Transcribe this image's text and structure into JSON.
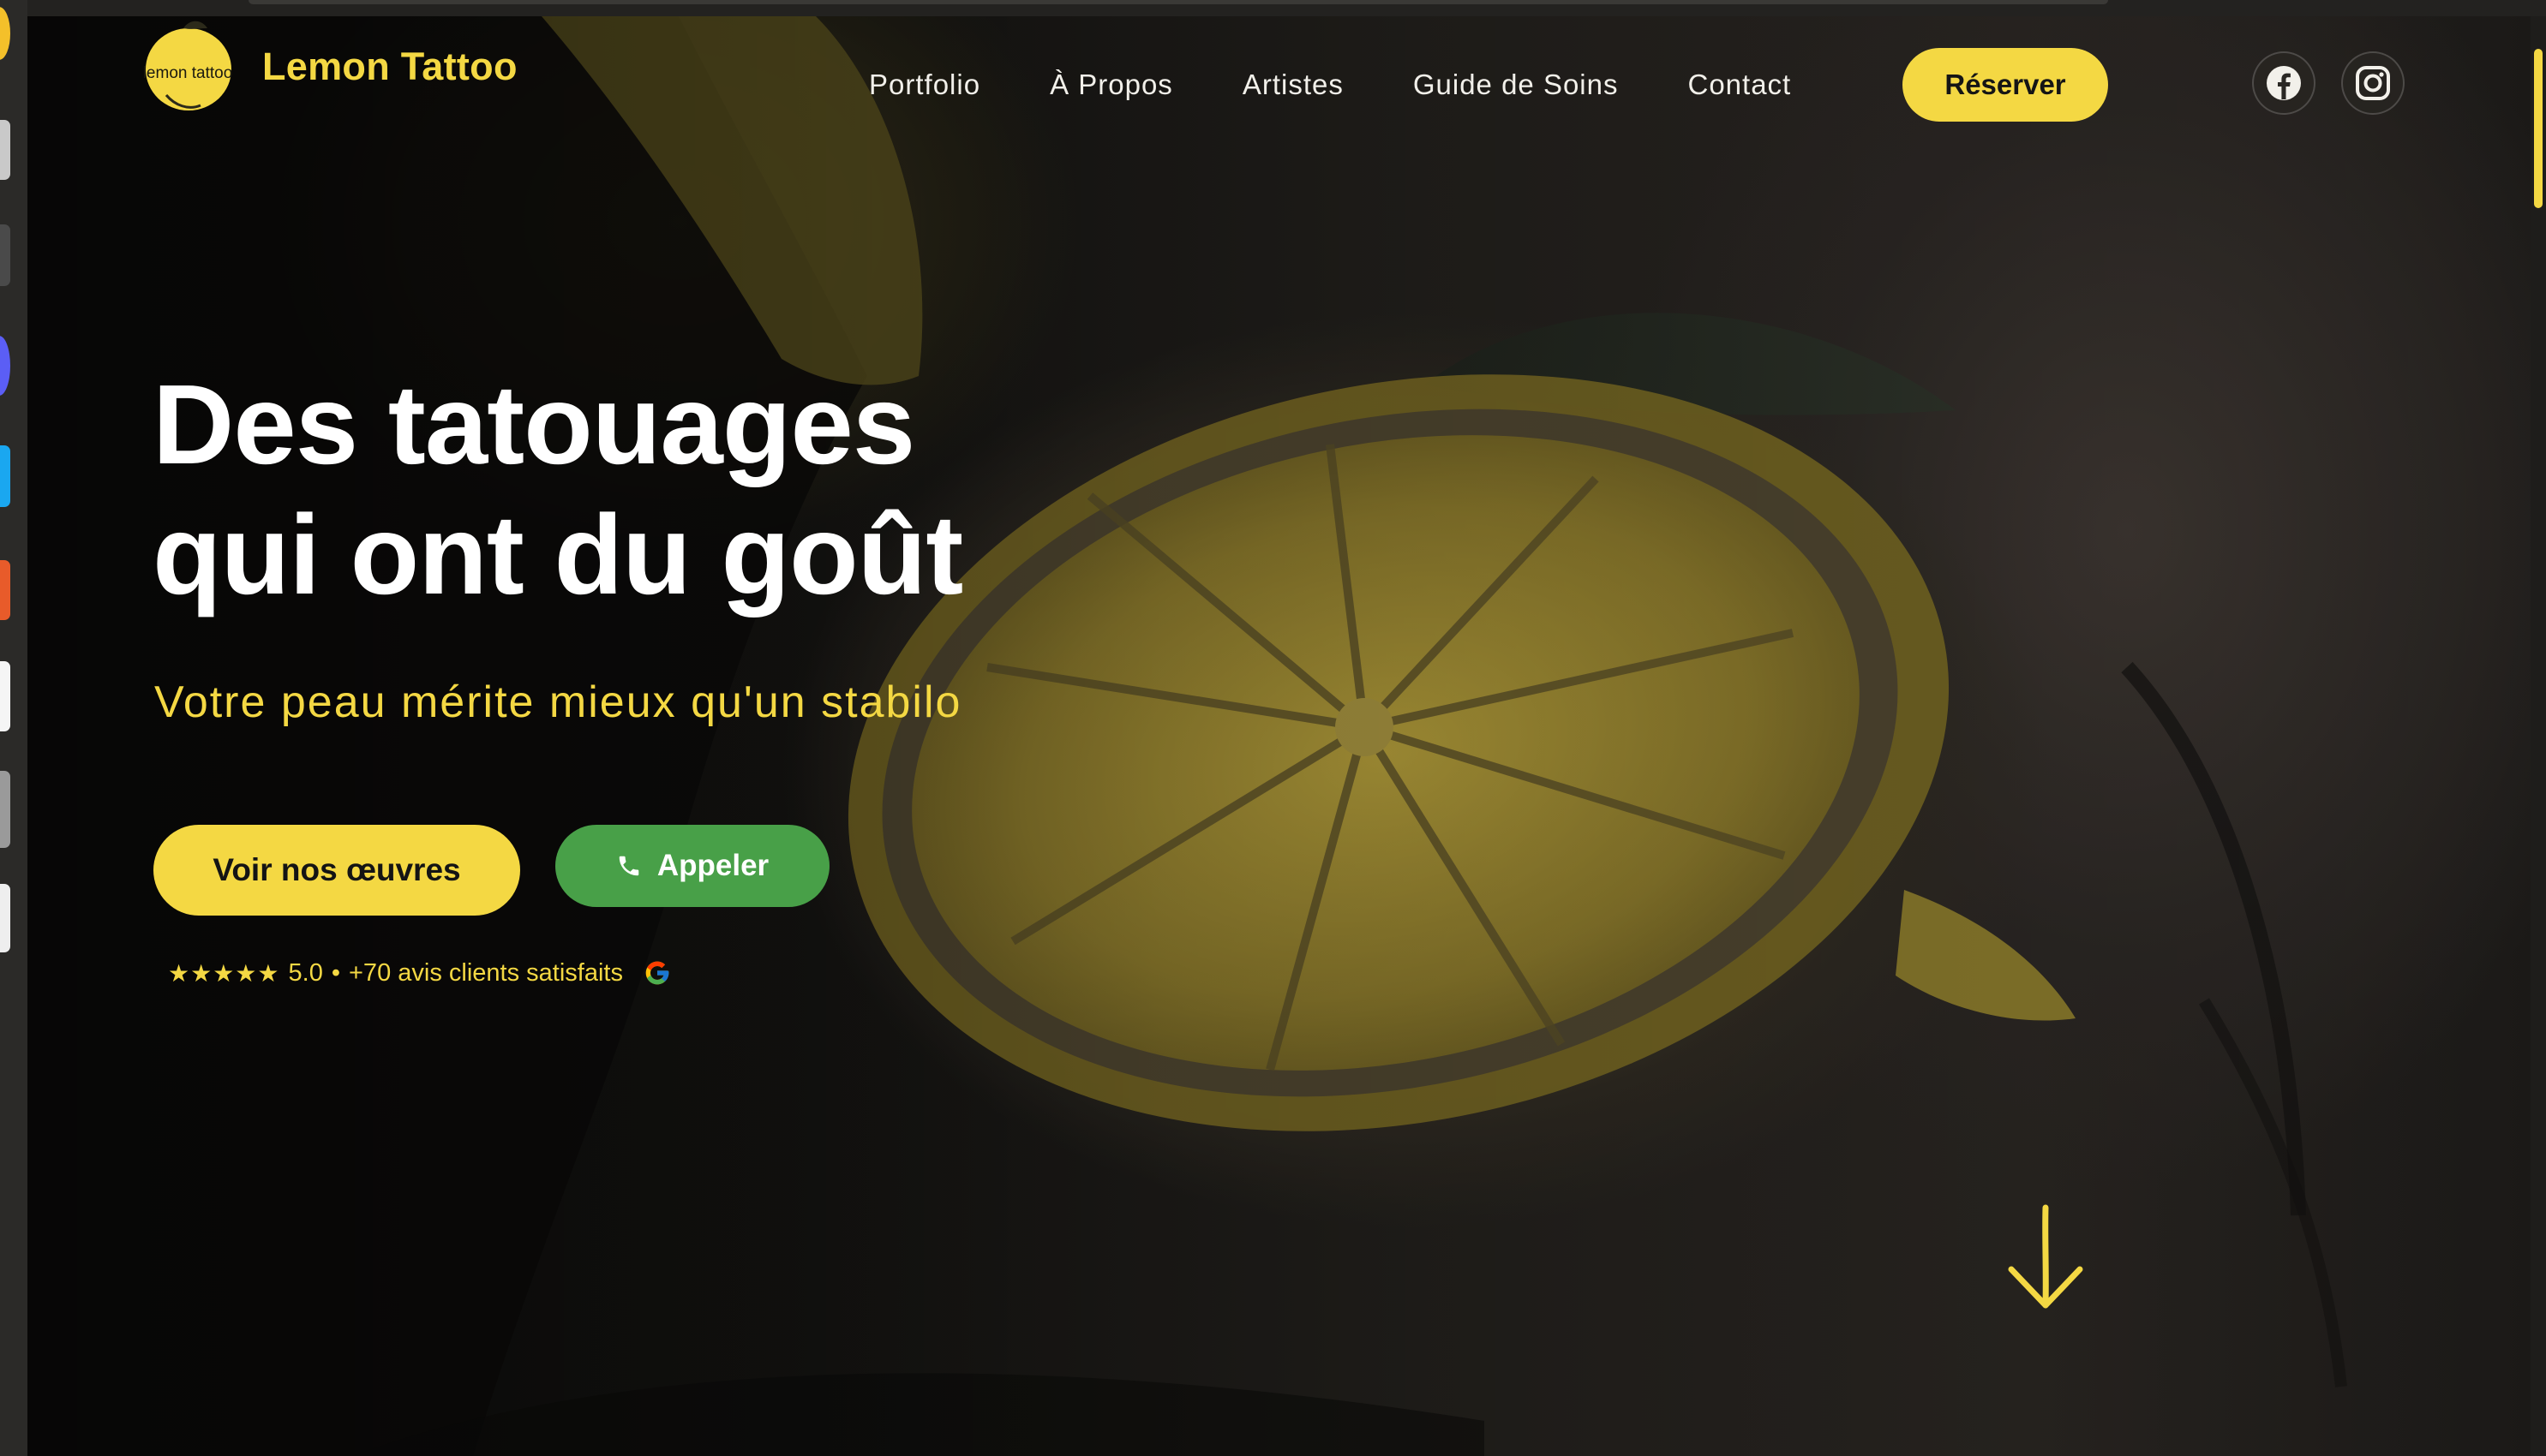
{
  "brand": {
    "name": "Lemon Tattoo",
    "logo_text": "lemon tattoo"
  },
  "nav": {
    "links": [
      "Portfolio",
      "À Propos",
      "Artistes",
      "Guide de Soins",
      "Contact"
    ],
    "cta": "Réserver",
    "social": [
      {
        "name": "facebook",
        "icon": "facebook-icon"
      },
      {
        "name": "instagram",
        "icon": "instagram-icon"
      }
    ]
  },
  "hero": {
    "title_line1": "Des tatouages",
    "title_line2": "qui ont du goût",
    "subtitle": "Votre peau mérite mieux qu'un stabilo",
    "primary_button": "Voir nos œuvres",
    "call_button": "Appeler",
    "rating": {
      "stars": "★★★★★",
      "score": "5.0",
      "separator": "•",
      "reviews": "+70 avis clients satisfaits",
      "source_icon": "google-icon"
    },
    "scroll_icon": "arrow-down-icon"
  },
  "colors": {
    "accent": "#f4d843",
    "call_green": "#48a048",
    "text_light": "#f2f0ea"
  }
}
